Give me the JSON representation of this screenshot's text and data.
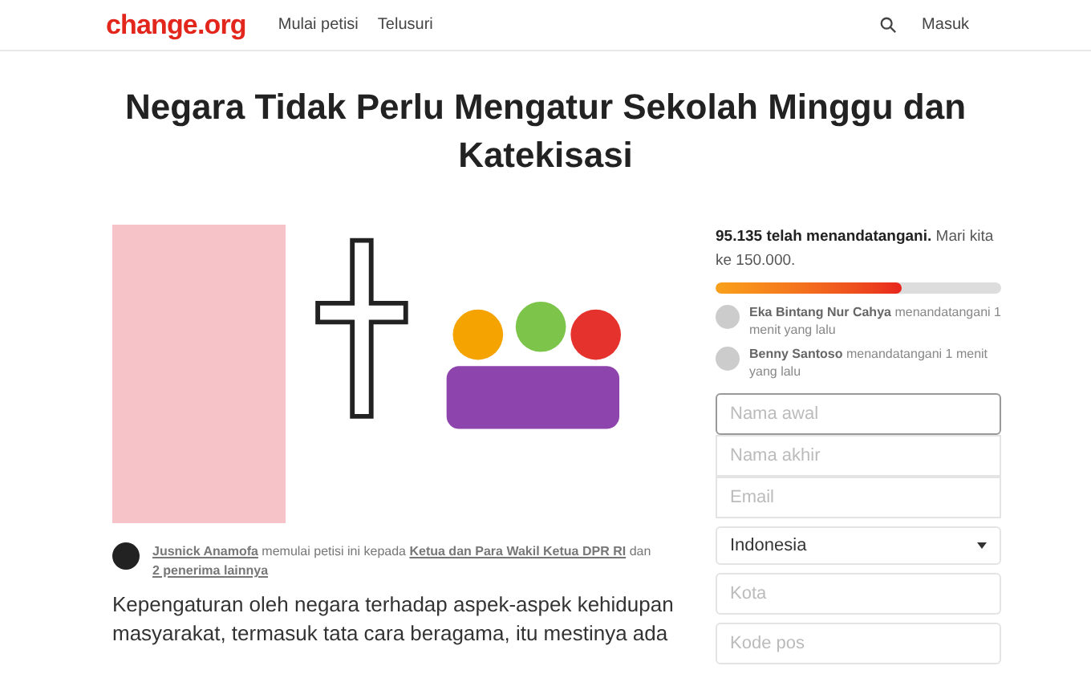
{
  "header": {
    "logo": "change.org",
    "nav": [
      {
        "label": "Mulai petisi"
      },
      {
        "label": "Telusuri"
      }
    ],
    "login": "Masuk"
  },
  "title": "Negara Tidak Perlu Mengatur Sekolah Minggu dan Katekisasi",
  "starter": {
    "name": "Jusnick Anamofa",
    "text": " memulai petisi ini kepada ",
    "recipient": "Ketua dan Para Wakil Ketua DPR RI",
    "joiner": " dan ",
    "others": "2 penerima lainnya"
  },
  "body": "Kepengaturan oleh negara terhadap aspek-aspek kehidupan masyarakat, termasuk tata cara beragama, itu mestinya ada",
  "progress": {
    "count": "95.135 telah menandatangani.",
    "goal": "Mari kita ke 150.000.",
    "level": 0.65
  },
  "recent": [
    {
      "name": "Eka Bintang Nur Cahya",
      "action": "menandatangani 1 menit yang lalu"
    },
    {
      "name": "Benny Santoso",
      "action": "menandatangani 1 menit yang lalu"
    }
  ],
  "form": {
    "fields": [
      {
        "kind": "input",
        "placeholder": "Nama awal",
        "focused": true
      },
      {
        "kind": "input",
        "placeholder": "Nama akhir",
        "focused": false
      },
      {
        "kind": "input",
        "placeholder": "Email",
        "focused": false
      },
      {
        "kind": "select",
        "value": "Indonesia",
        "focused": false
      },
      {
        "kind": "input",
        "placeholder": "Kota",
        "focused": false
      },
      {
        "kind": "input",
        "placeholder": "Kode pos",
        "focused": false
      }
    ]
  }
}
